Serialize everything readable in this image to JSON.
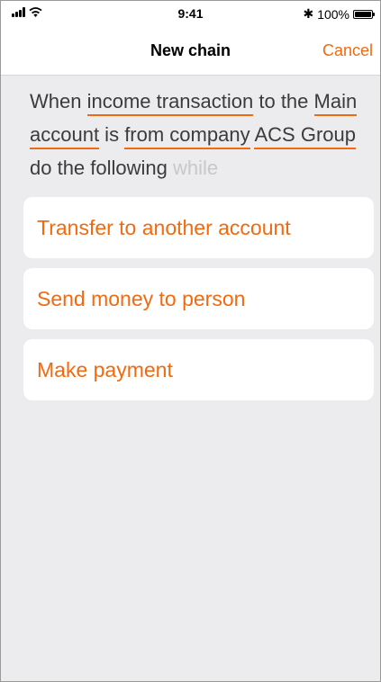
{
  "status_bar": {
    "time": "9:41",
    "battery": "100%",
    "bluetooth_glyph": "✱"
  },
  "nav": {
    "title": "New chain",
    "cancel": "Cancel"
  },
  "sentence": {
    "p1": "When ",
    "income_transaction": "income transaction",
    "p2": " to the ",
    "main_account": "Main account",
    "p3": " is ",
    "from_company": "from company",
    "p4": " ",
    "acs_group": "ACS Group",
    "p5": " do the following ",
    "while": "while"
  },
  "options": [
    "Transfer to another account",
    "Send money to person",
    "Make payment"
  ],
  "colors": {
    "accent": "#f26a10",
    "background": "#ececee",
    "text": "#3b3b3d"
  }
}
